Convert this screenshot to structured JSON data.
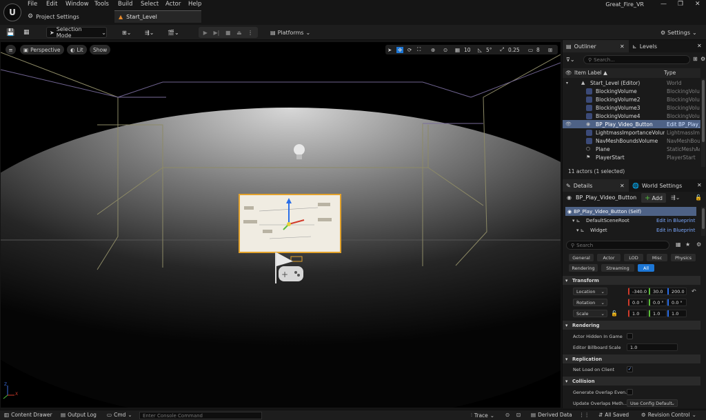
{
  "menu": [
    "File",
    "Edit",
    "Window",
    "Tools",
    "Build",
    "Select",
    "Actor",
    "Help"
  ],
  "tabs": {
    "project_settings": "Project Settings",
    "level": "Start_Level"
  },
  "app_title": "Great_Fire_VR",
  "window_controls": {
    "minimize": "—",
    "maximize": "❐",
    "close": "✕"
  },
  "toolbar": {
    "selection_mode": "Selection Mode",
    "platforms": "Platforms",
    "settings": "Settings"
  },
  "viewport": {
    "perspective": "Perspective",
    "lit": "Lit",
    "show": "Show",
    "grid_snap": "10",
    "rotation_snap": "5°",
    "scale_snap": "0.25",
    "camera_speed": "8",
    "axis_labels": {
      "z": "Z",
      "x": "X"
    }
  },
  "outliner": {
    "tab_outliner": "Outliner",
    "tab_levels": "Levels",
    "search_placeholder": "Search...",
    "col_label": "Item Label ▲",
    "col_type": "Type",
    "rows": [
      {
        "name": "Start_Level (Editor)",
        "type": "World"
      },
      {
        "name": "BlockingVolume",
        "type": "BlockingVolume"
      },
      {
        "name": "BlockingVolume2",
        "type": "BlockingVolume"
      },
      {
        "name": "BlockingVolume3",
        "type": "BlockingVolume"
      },
      {
        "name": "BlockingVolume4",
        "type": "BlockingVolume"
      },
      {
        "name": "BP_Play_Video_Button",
        "type": "Edit BP_Play_"
      },
      {
        "name": "LightmassImportanceVolume",
        "type": "LightmassImportanceVolume"
      },
      {
        "name": "NavMeshBoundsVolume",
        "type": "NavMeshBoundsVolume"
      },
      {
        "name": "Plane",
        "type": "StaticMeshActor"
      },
      {
        "name": "PlayerStart",
        "type": "PlayerStart"
      }
    ],
    "status": "11 actors (1 selected)"
  },
  "details": {
    "tab_details": "Details",
    "tab_world_settings": "World Settings",
    "actor_name": "BP_Play_Video_Button",
    "add_label": "Add",
    "components": [
      {
        "name": "BP_Play_Video_Button (Self)",
        "link": ""
      },
      {
        "name": "DefaultSceneRoot",
        "link": "Edit in Blueprint"
      },
      {
        "name": "Widget",
        "link": "Edit in Blueprint"
      }
    ],
    "search_placeholder": "Search",
    "categories_row1": [
      "General",
      "Actor",
      "LOD",
      "Misc",
      "Physics"
    ],
    "categories_row2": [
      "Rendering",
      "Streaming",
      "All"
    ],
    "transform": {
      "header": "Transform",
      "location_label": "Location",
      "rotation_label": "Rotation",
      "scale_label": "Scale",
      "location": [
        "-340.0",
        "30.0",
        "200.0"
      ],
      "rotation": [
        "0.0 °",
        "0.0 °",
        "0.0 °"
      ],
      "scale": [
        "1.0",
        "1.0",
        "1.0"
      ]
    },
    "rendering": {
      "header": "Rendering",
      "actor_hidden": "Actor Hidden In Game",
      "billboard_label": "Editor Billboard Scale",
      "billboard_value": "1.0"
    },
    "replication": {
      "header": "Replication",
      "net_load": "Net Load on Client"
    },
    "collision": {
      "header": "Collision",
      "overlap_events": "Generate Overlap Even...",
      "update_overlaps": "Update Overlaps Meth...",
      "update_overlaps_value": "Use Config Default"
    }
  },
  "statusbar": {
    "content_drawer": "Content Drawer",
    "output_log": "Output Log",
    "cmd": "Cmd",
    "console_placeholder": "Enter Console Command",
    "trace": "Trace",
    "derived_data": "Derived Data",
    "all_saved": "All Saved",
    "revision_control": "Revision Control"
  },
  "colors": {
    "accent": "#1d77d6",
    "selected_row": "#4e6286",
    "background": "#151515",
    "panel": "#1a1a1a"
  }
}
